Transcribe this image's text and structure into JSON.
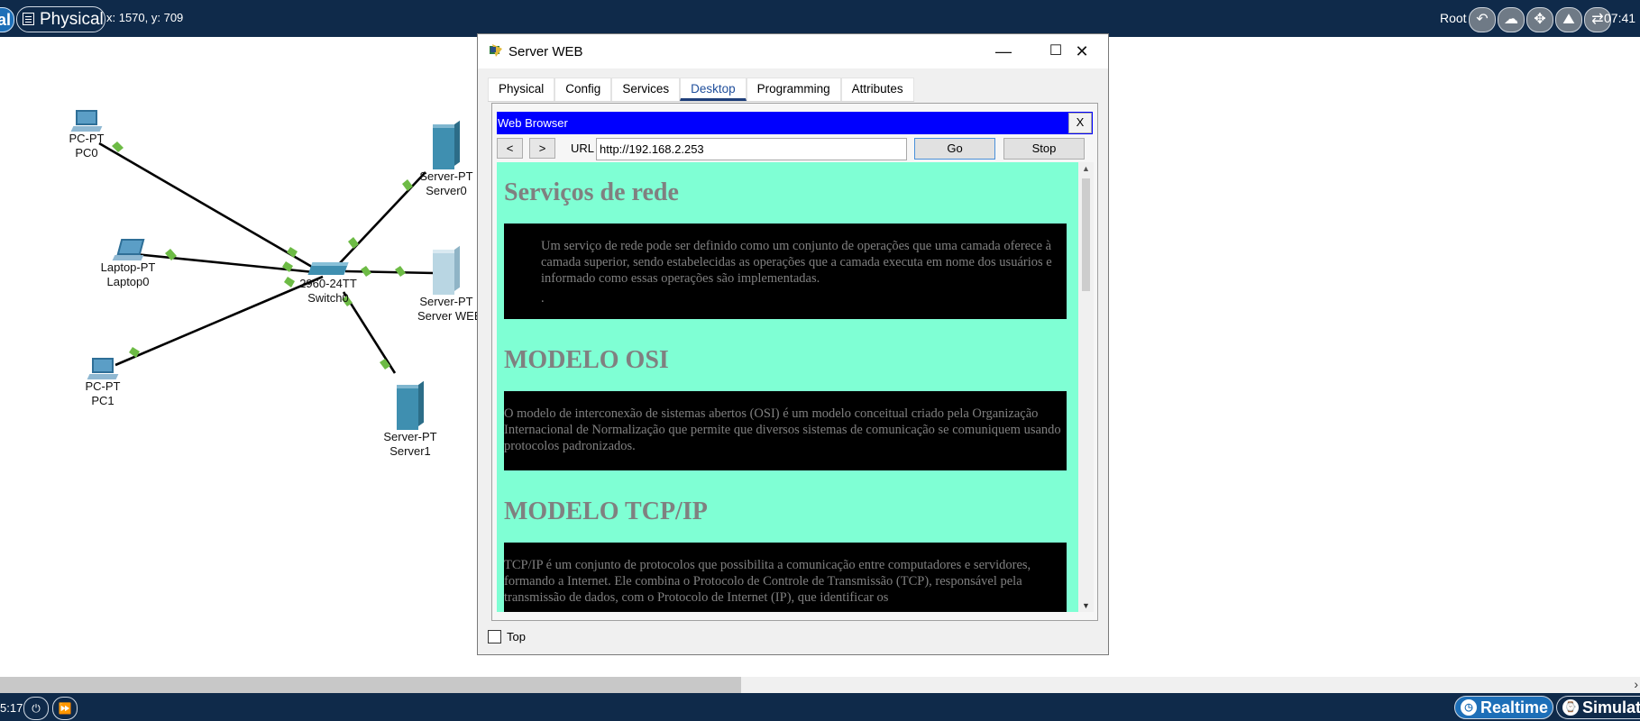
{
  "topbar": {
    "left_pill_text": "al",
    "mode": "Physical",
    "coords": "x: 1570, y: 709",
    "root": "Root",
    "clock": "07:41",
    "icons": [
      "undo-icon",
      "cloud-icon",
      "move-icon",
      "landscape-icon",
      "network-icon"
    ]
  },
  "devices": {
    "pc0": {
      "type": "PC-PT",
      "name": "PC0"
    },
    "laptop0": {
      "type": "Laptop-PT",
      "name": "Laptop0"
    },
    "pc1": {
      "type": "PC-PT",
      "name": "PC1"
    },
    "switch0": {
      "type": "2960-24TT",
      "name": "Switch0"
    },
    "server0": {
      "type": "Server-PT",
      "name": "Server0"
    },
    "serverweb": {
      "type": "Server-PT",
      "name": "Server WEB"
    },
    "server1": {
      "type": "Server-PT",
      "name": "Server1"
    }
  },
  "window": {
    "title": "Server WEB",
    "minimize": "—",
    "maximize": "☐",
    "close": "✕",
    "tabs": [
      "Physical",
      "Config",
      "Services",
      "Desktop",
      "Programming",
      "Attributes"
    ],
    "active_tab": "Desktop",
    "top_label": "Top"
  },
  "browser": {
    "title": "Web Browser",
    "close": "X",
    "back": "<",
    "forward": ">",
    "url_label": "URL",
    "url": "http://192.168.2.253",
    "go": "Go",
    "stop": "Stop",
    "page": {
      "h1": "Serviços de rede",
      "p1": "Um serviço de rede pode ser definido como um conjunto de operações que uma camada oferece à camada superior, sendo estabelecidas as operações que a camada executa em nome dos usuários e informado como essas operações são implementadas.",
      "p1_dot": ".",
      "h2": "MODELO OSI",
      "p2": "O modelo de interconexão de sistemas abertos (OSI) é um modelo conceitual criado pela Organização Internacional de Normalização que permite que diversos sistemas de comunicação se comuniquem usando protocolos padronizados.",
      "h3": "MODELO TCP/IP",
      "p3": "TCP/IP é um conjunto de protocolos que possibilita a comunicação entre computadores e servidores, formando a Internet. Ele combina o Protocolo de Controle de Transmissão (TCP), responsável pela transmissão de dados, com o Protocolo de Internet (IP), que identificar os"
    }
  },
  "bottombar": {
    "time": "5:17",
    "realtime": "Realtime",
    "simulation": "Simulation"
  },
  "colors": {
    "topbar": "#0f2a4a",
    "link_line": "#000000",
    "link_up": "#6dbb45",
    "browser_titlebar": "#0000ff",
    "page_bg": "#7fffd4"
  }
}
